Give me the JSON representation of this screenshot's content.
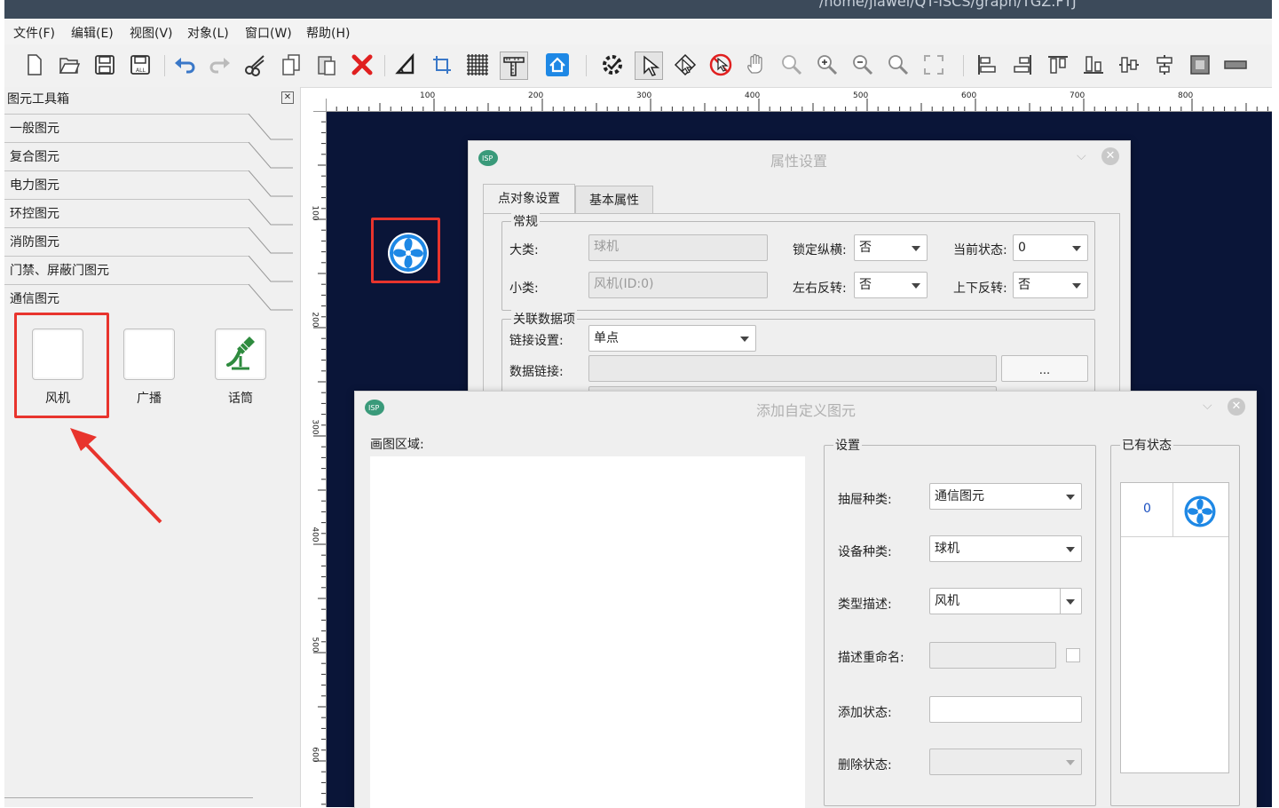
{
  "window": {
    "title": "/home/jiawei/QT-ISCS/graph/TGZ.FTJ"
  },
  "menu": [
    "文件(F)",
    "编辑(E)",
    "视图(V)",
    "对象(L)",
    "窗口(W)",
    "帮助(H)"
  ],
  "toolbox": {
    "title": "图元工具箱",
    "close_glyph": "✕",
    "categories": [
      "一般图元",
      "复合图元",
      "电力图元",
      "环控图元",
      "消防图元",
      "门禁、屏蔽门图元",
      "通信图元"
    ],
    "items": [
      "风机",
      "广播",
      "话筒"
    ]
  },
  "ruler": {
    "top_labels": [
      "100",
      "200",
      "300",
      "400",
      "500",
      "600",
      "700",
      "800"
    ],
    "left_labels": [
      "100",
      "200",
      "300",
      "400",
      "500",
      "600"
    ]
  },
  "props_dialog": {
    "title": "属性设置",
    "tabs": [
      "点对象设置",
      "基本属性"
    ],
    "general": {
      "title": "常规",
      "major_label": "大类:",
      "major_value": "球机",
      "minor_label": "小类:",
      "minor_value": "风机(ID:0)",
      "lock_label": "锁定纵横:",
      "lock_value": "否",
      "state_label": "当前状态:",
      "state_value": "0",
      "hflip_label": "左右反转:",
      "hflip_value": "否",
      "vflip_label": "上下反转:",
      "vflip_value": "否"
    },
    "link": {
      "title": "关联数据项",
      "link_label": "链接设置:",
      "link_value": "单点",
      "data_label": "数据链接:",
      "browse": "..."
    }
  },
  "add_dialog": {
    "title": "添加自定义图元",
    "draw_area_label": "画图区域:",
    "settings": {
      "title": "设置",
      "drawer_label": "抽屉种类:",
      "drawer_value": "通信图元",
      "device_label": "设备种类:",
      "device_value": "球机",
      "desc_label": "类型描述:",
      "desc_value": "风机",
      "rename_label": "描述重命名:",
      "add_state_label": "添加状态:",
      "del_state_label": "删除状态:"
    },
    "states": {
      "title": "已有状态",
      "rows": [
        {
          "id": "0"
        }
      ]
    }
  },
  "colors": {
    "canvas_bg": "#0a1538",
    "highlight": "#e8342d",
    "fan_blue": "#1e88e5"
  }
}
